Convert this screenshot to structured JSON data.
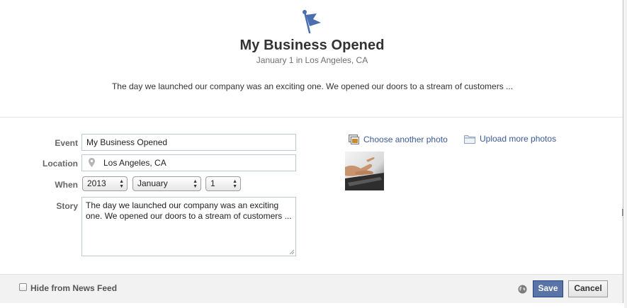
{
  "header": {
    "icon": "flag-icon",
    "title": "My Business Opened",
    "subtitle": "January 1 in Los Angeles, CA",
    "description": "The day we launched our company was an exciting one. We opened our doors to a stream of customers ..."
  },
  "form": {
    "event_label": "Event",
    "event_value": "My Business Opened",
    "location_label": "Location",
    "location_value": "Los Angeles, CA",
    "location_icon": "map-pin-icon",
    "when_label": "When",
    "year_value": "2013",
    "month_value": "January",
    "day_value": "1",
    "story_label": "Story",
    "story_value": "The day we launched our company was an exciting one. We opened our doors to a stream of customers ..."
  },
  "photos": {
    "choose_label": "Choose another photo",
    "choose_icon": "photo-frame-icon",
    "upload_label": "Upload more photos",
    "upload_icon": "folder-icon",
    "thumbnail": "hands-typing-on-laptop"
  },
  "footer": {
    "hide_label": "Hide from News Feed",
    "hide_checked": false,
    "privacy_icon": "globe-icon",
    "save_label": "Save",
    "cancel_label": "Cancel"
  },
  "colors": {
    "link": "#3b5998",
    "save_button": "#5b74a8",
    "flag": "#4a6fb0"
  }
}
